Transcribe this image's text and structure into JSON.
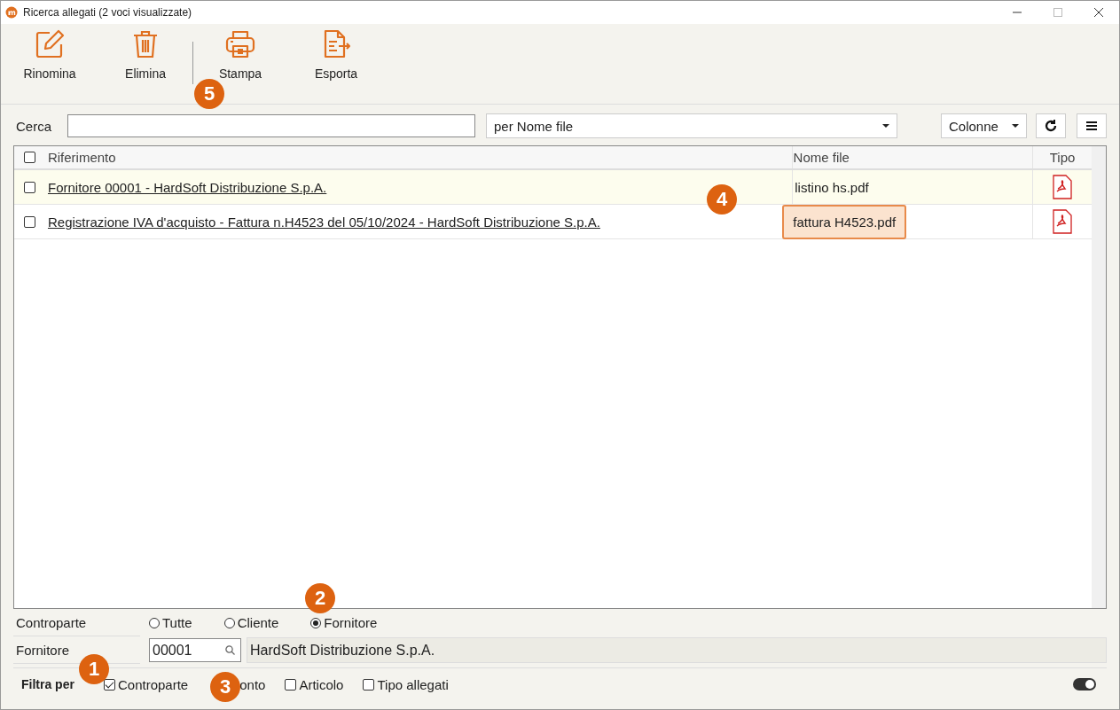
{
  "window": {
    "title": "Ricerca allegati (2 voci visualizzate)"
  },
  "toolbar": [
    {
      "label": "Rinomina"
    },
    {
      "label": "Elimina"
    },
    {
      "label": "Stampa"
    },
    {
      "label": "Esporta"
    }
  ],
  "search": {
    "label": "Cerca",
    "mode": "per Nome file",
    "columns_button": "Colonne"
  },
  "table": {
    "columns": [
      "Riferimento",
      "Nome file",
      "Tipo"
    ],
    "all_checked": false,
    "rows": [
      {
        "checked": false,
        "riferimento": "Fornitore 00001 - HardSoft Distribuzione S.p.A.",
        "nome_file": "listino hs.pdf",
        "highlighted": true,
        "file_marked": false
      },
      {
        "checked": false,
        "riferimento": "Registrazione IVA d'acquisto - Fattura n.H4523 del 05/10/2024 - HardSoft Distribuzione S.p.A.",
        "nome_file": "fattura H4523.pdf",
        "highlighted": false,
        "file_marked": true
      }
    ]
  },
  "controparte": {
    "label": "Controparte",
    "options": [
      {
        "label": "Tutte",
        "selected": false
      },
      {
        "label": "Cliente",
        "selected": false
      },
      {
        "label": "Fornitore",
        "selected": true
      }
    ]
  },
  "fornitore": {
    "label": "Fornitore",
    "code": "00001",
    "name": "HardSoft Distribuzione S.p.A."
  },
  "filtra_per": {
    "label": "Filtra per",
    "options": [
      {
        "label": "Controparte",
        "checked": true
      },
      {
        "label": "onto"
      },
      {
        "label": "Articolo",
        "checked": false
      },
      {
        "label": "Tipo allegati",
        "checked": false
      }
    ],
    "toggle_on": true
  },
  "callouts": [
    "1",
    "2",
    "3",
    "4",
    "5"
  ]
}
